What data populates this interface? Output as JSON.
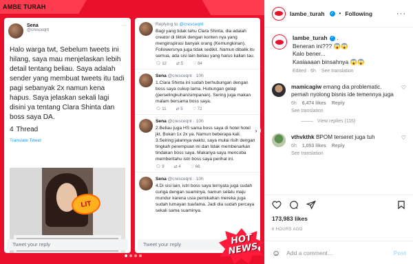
{
  "post_image": {
    "brand": "AMBE TURAH",
    "left_tweet": {
      "name": "Sena",
      "handle": "@cresceqnt",
      "body": "Halo warga twt, Sebelum tweets ini hilang, saya mau menjelaskan lebih detail tentang beliau. Saya adalah sender yang membuat tweets itu tadi pagi sebanyak 2x namun kena hapus. Saya jelaskan sekali lagi disini ya tentang Clara Shinta dan boss saya DA.",
      "thread": "Thread",
      "thread_num": "4",
      "translate": "Translate Tweet",
      "sticker": "LIT",
      "reply_placeholder": "Tweet your reply"
    },
    "right_thread": {
      "replying_to_prefix": "Replying to",
      "replying_to_handle": "@cresceqnt",
      "first_text": "Bagi yang tidak tahu Clara Shinta, dia adalah creator di tiktok dengan konten nya yang menginspirasi banyak orang (Kemungkinan). Followersnya juga tidak sedikit. Namun dibalik itu semua, ada sisi lain beliau yang harus kalian tau.",
      "first_stats": [
        "12",
        "5",
        "84"
      ],
      "tweets": [
        {
          "name": "Sena",
          "handle": "@cresceqnt · 10h",
          "text": "1.Clara Shinta ini sudah berhubungan dengan boss saya cukup lama. Hubungan gelap (perselingkuhan/simpanan). Sering juga makan malam bersama boss saya.",
          "stats": [
            "11",
            "5",
            "72"
          ]
        },
        {
          "name": "Sena",
          "handle": "@cresceqnt · 10h",
          "text": "2.Beliau juga HS sama boss saya di hotel hotel jkt. Bukan 1x 2x ya. Namun beberapa kali.\n3.Seiring jalannya waktu, saya mulai risih dengan tingkah perempuan ini dan tidak membenarkan tindakan boss saya. Makanya saya mencoba memberitahu istri boss saya perihal ini.",
          "stats": [
            "9",
            "4",
            "66"
          ]
        },
        {
          "name": "Sena",
          "handle": "@cresceqnt · 10h",
          "text": "4.Di sisi lain, istri boss saya ternyata juga sudah curiga dengan suaminya, namun selalu maju mundur karena usia pernikahan mereka juga sudah lumayan tua/lama. Jadi dia sudah percaya sekali sama suaminya."
        }
      ],
      "reply_placeholder": "Tweet your reply"
    },
    "hot_news": [
      "HOT",
      "NEWS"
    ]
  },
  "panel": {
    "username": "lambe_turah",
    "follow_state": "Following",
    "caption": {
      "username": "lambe_turah",
      "lines": [
        "Beneran ini??? 😱😱",
        "Kalo bener...",
        "Kasiaaaan binsahnya 😱😱"
      ],
      "edited": "Edited · 6h",
      "see_translation": "See translation"
    },
    "comments": [
      {
        "username": "mamicagiw",
        "text": "emang dia problematic. pernah nyolong bisnis ide temennya juga",
        "time": "6h",
        "likes": "6,474 likes",
        "reply": "Reply",
        "see_translation": "See translation",
        "view_replies": "View replies (116)"
      },
      {
        "username": "vthvkthk",
        "text": "BPOM terseret juga tuh",
        "time": "6h",
        "likes": "1,053 likes",
        "reply": "Reply",
        "see_translation": "See translation"
      }
    ],
    "likes_count": "173,983 likes",
    "posted": "6 HOURS AGO",
    "add_comment_placeholder": "Add a comment…",
    "post_label": "Post"
  }
}
